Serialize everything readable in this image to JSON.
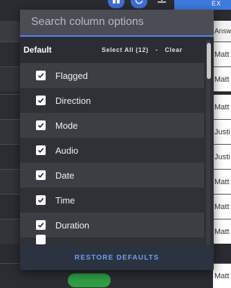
{
  "toolbar": {
    "export_label": "EX",
    "icons": [
      "columns-icon",
      "refresh-icon",
      "download-icon"
    ]
  },
  "table": {
    "header_right": "Answ",
    "rows_right": [
      "Matt",
      "Matt",
      "Matt",
      "Justi",
      "Justi",
      "Matt",
      "Matt",
      "Matt",
      "Matt"
    ]
  },
  "column_menu": {
    "search_placeholder": "Search column options",
    "search_value": "",
    "group_title": "Default",
    "select_all_label": "Select All (12)",
    "separator": "-",
    "clear_label": "Clear",
    "columns": [
      {
        "label": "Flagged",
        "checked": true
      },
      {
        "label": "Direction",
        "checked": true
      },
      {
        "label": "Mode",
        "checked": true
      },
      {
        "label": "Audio",
        "checked": true
      },
      {
        "label": "Date",
        "checked": true
      },
      {
        "label": "Time",
        "checked": true
      },
      {
        "label": "Duration",
        "checked": true
      },
      {
        "label": "",
        "checked": true
      }
    ],
    "restore_label": "RESTORE DEFAULTS"
  },
  "colors": {
    "accent": "#4e8bf5",
    "panel_bg": "#2e3035",
    "footer_text": "#6f9ff0",
    "checkbox_tick": "#2e3035"
  }
}
